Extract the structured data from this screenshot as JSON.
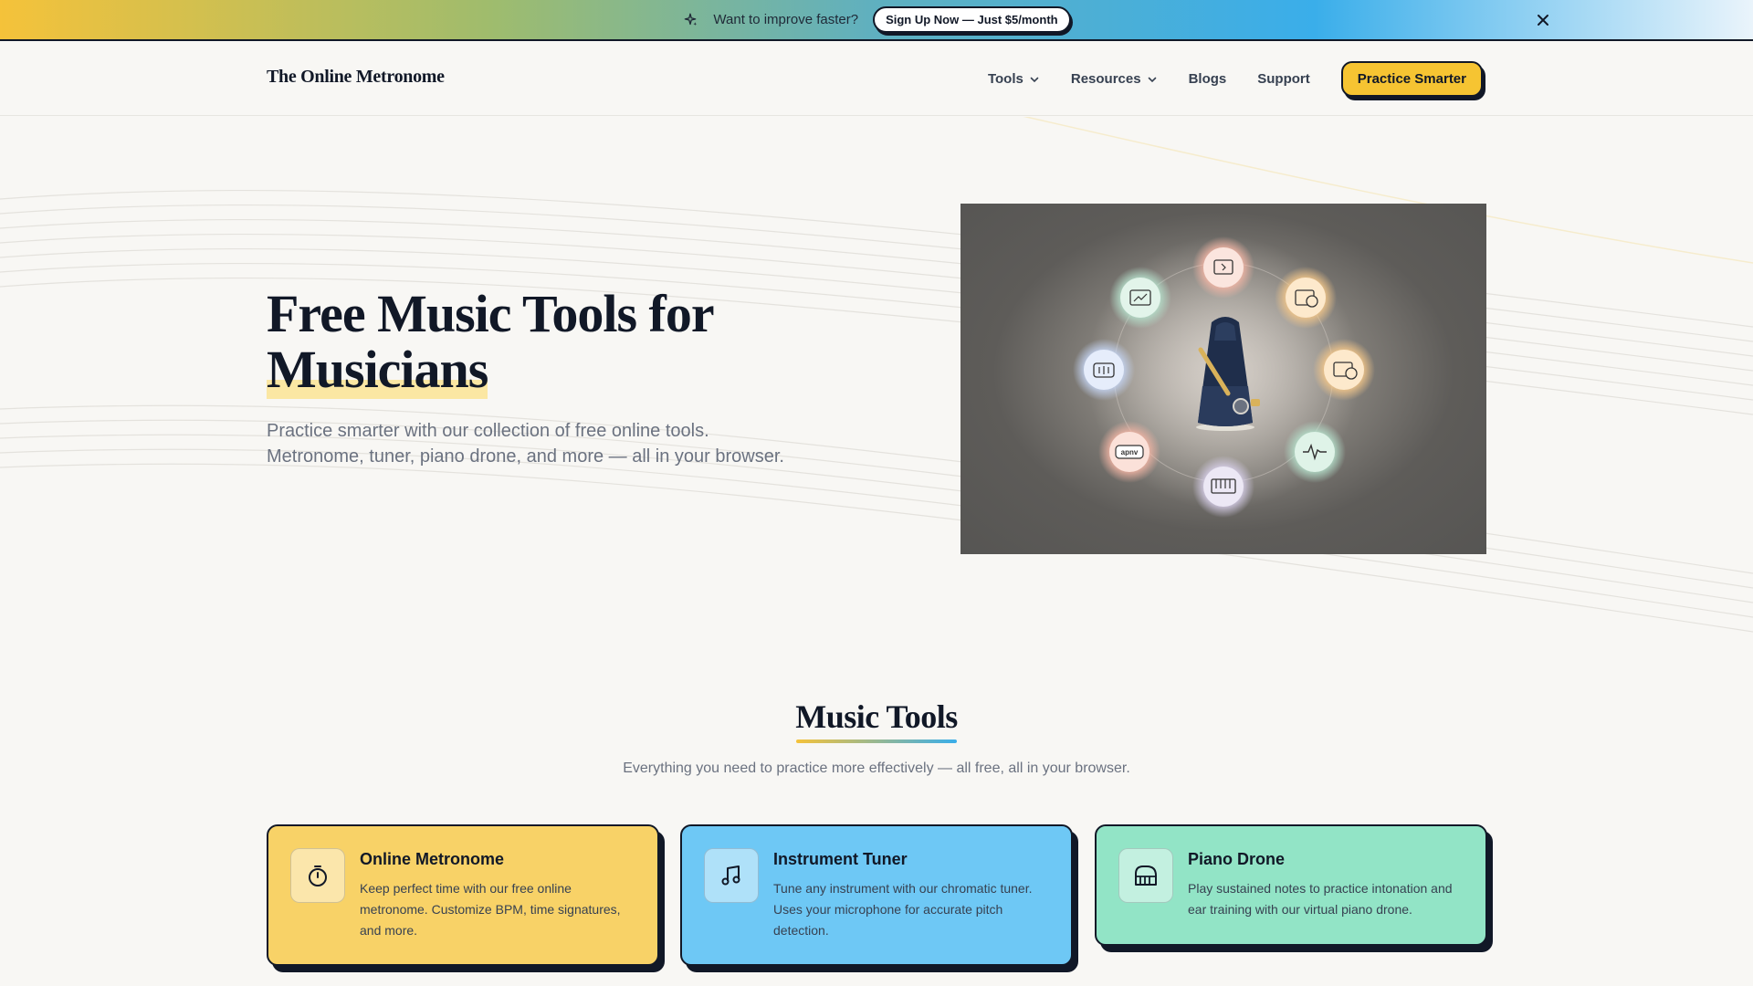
{
  "promo": {
    "text": "Want to improve faster?",
    "signup_label": "Sign Up Now — Just $5/month"
  },
  "header": {
    "brand": "The Online Metronome",
    "nav": [
      {
        "label": "Tools",
        "has_dropdown": true
      },
      {
        "label": "Resources",
        "has_dropdown": true
      },
      {
        "label": "Blogs",
        "has_dropdown": false
      },
      {
        "label": "Support",
        "has_dropdown": false
      }
    ],
    "cta_label": "Practice Smarter"
  },
  "hero": {
    "title_line1": "Free Music Tools for",
    "title_line2": "Musicians",
    "subtitle_line1": "Practice smarter with our collection of free online tools.",
    "subtitle_line2": "Metronome, tuner, piano drone, and more — all in your browser.",
    "image_badge_text": "apnv"
  },
  "tools_section": {
    "title": "Music Tools",
    "subtitle": "Everything you need to practice more effectively — all free, all in your browser.",
    "cards": [
      {
        "title": "Online Metronome",
        "description": "Keep perfect time with our free online metronome. Customize BPM, time signatures, and more.",
        "icon": "stopwatch-icon",
        "color": "#f8d267"
      },
      {
        "title": "Instrument Tuner",
        "description": "Tune any instrument with our chromatic tuner. Uses your microphone for accurate pitch detection.",
        "icon": "music-note-icon",
        "color": "#6ec8f5"
      },
      {
        "title": "Piano Drone",
        "description": "Play sustained notes to practice intonation and ear training with our virtual piano drone.",
        "icon": "piano-icon",
        "color": "#92e4c6"
      }
    ]
  },
  "colors": {
    "accent_yellow": "#f6c432",
    "accent_blue": "#3aaeea",
    "text_dark": "#111827",
    "text_muted": "#6b7280"
  }
}
